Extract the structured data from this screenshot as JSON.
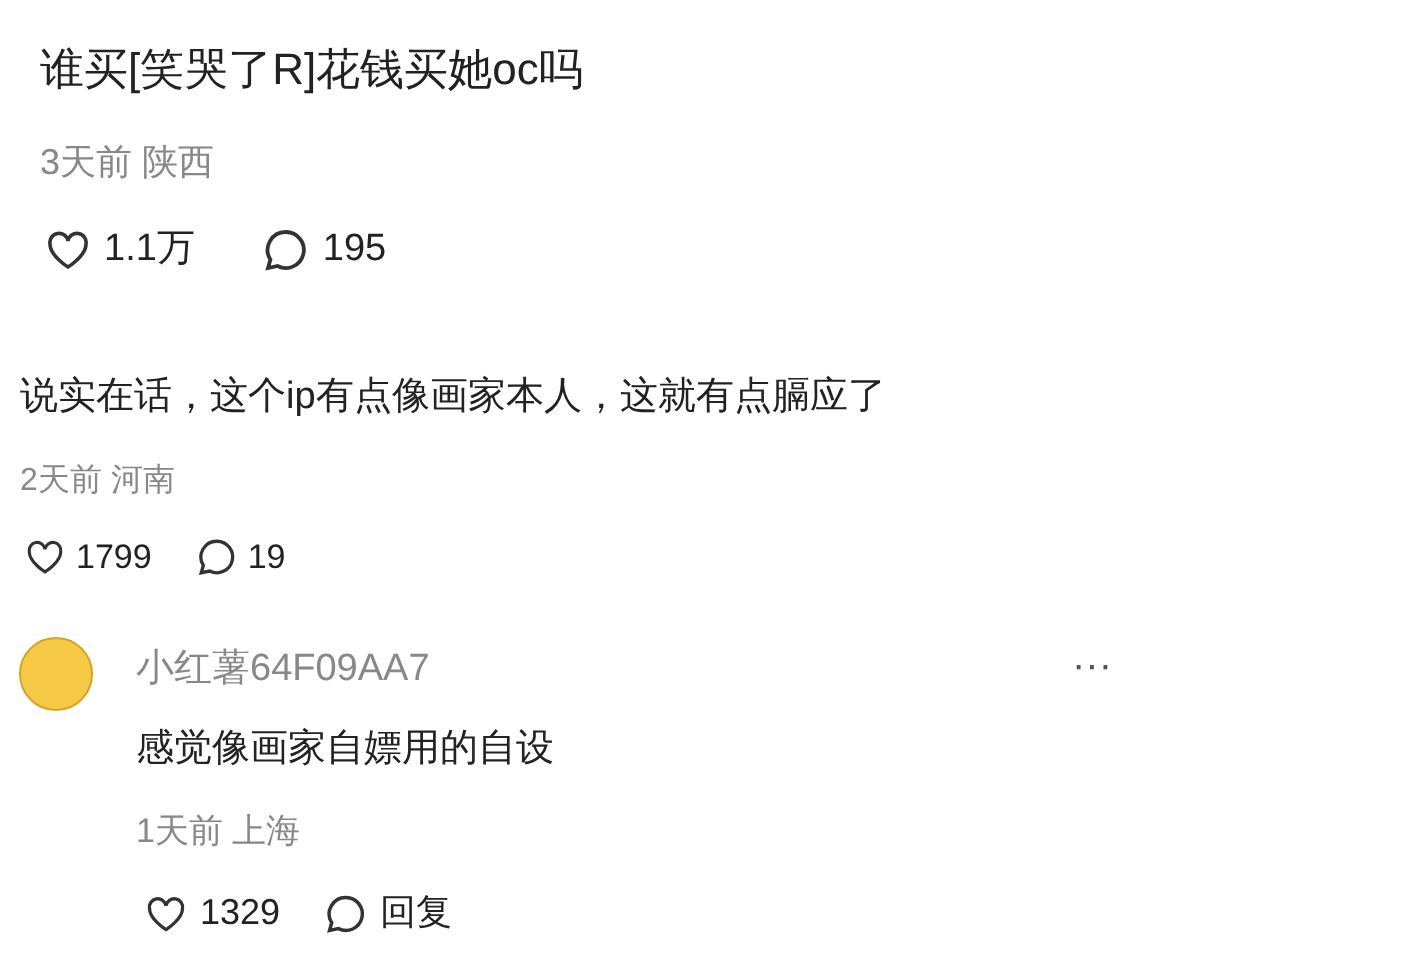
{
  "post": {
    "text": "谁买[笑哭了R]花钱买她oc吗",
    "meta": "3天前 陕西",
    "likes": "1.1万",
    "comments": "195"
  },
  "comment": {
    "text": "说实在话，这个ip有点像画家本人，这就有点膈应了",
    "meta": "2天前 河南",
    "likes": "1799",
    "comments": "19"
  },
  "reply": {
    "user": "小红薯64F09AA7",
    "more": "···",
    "text": "感觉像画家自嫖用的自设",
    "meta": "1天前 上海",
    "likes": "1329",
    "reply_label": "回复"
  }
}
